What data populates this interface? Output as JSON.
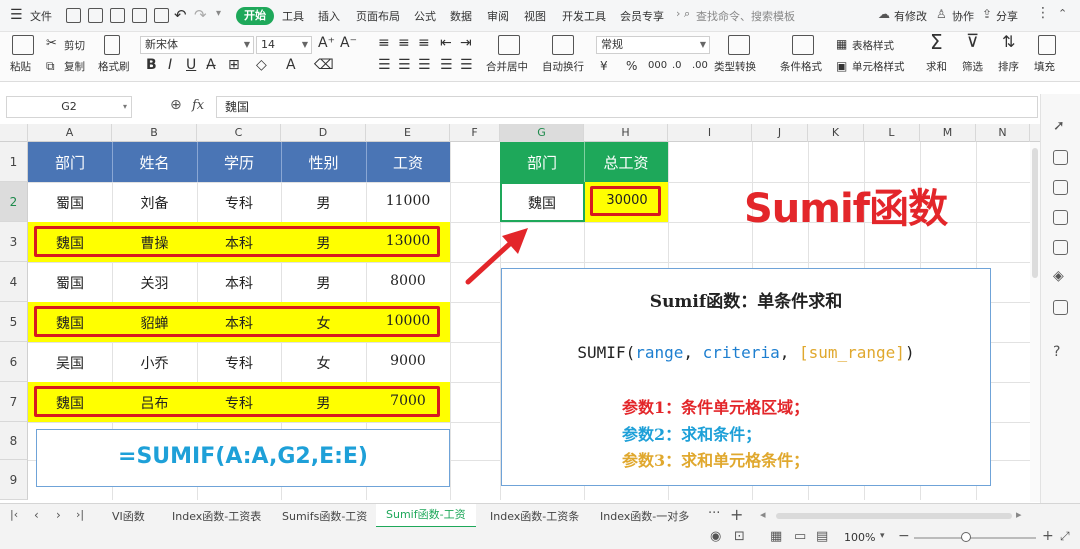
{
  "menubar": {
    "file": "文件",
    "tabs": [
      "开始",
      "工具",
      "插入",
      "页面布局",
      "公式",
      "数据",
      "审阅",
      "视图",
      "开发工具",
      "会员专享"
    ],
    "active_tab": "开始",
    "search_placeholder": "查找命令、搜索模板",
    "has_edit": "有修改",
    "collab": "协作",
    "share": "分享"
  },
  "ribbon": {
    "paste": "粘贴",
    "cut": "剪切",
    "copy": "复制",
    "format_painter": "格式刷",
    "font_name": "新宋体",
    "font_size": "14",
    "merge": "合并居中",
    "wrap": "自动换行",
    "number_format": "常规",
    "type_convert": "类型转换",
    "cond_format": "条件格式",
    "table_style": "表格样式",
    "cell_style": "单元格样式",
    "sum": "求和",
    "filter": "筛选",
    "sort": "排序",
    "fill": "填充"
  },
  "formula_bar": {
    "name_box": "G2",
    "fx": "fx",
    "content": "魏国"
  },
  "columns": [
    "A",
    "B",
    "C",
    "D",
    "E",
    "F",
    "G",
    "H",
    "I",
    "J",
    "K",
    "L",
    "M",
    "N"
  ],
  "rows": [
    "1",
    "2",
    "3",
    "4",
    "5",
    "6",
    "7",
    "8",
    "9"
  ],
  "table": {
    "headers": [
      "部门",
      "姓名",
      "学历",
      "性别",
      "工资"
    ],
    "rows": [
      [
        "蜀国",
        "刘备",
        "专科",
        "男",
        "11000"
      ],
      [
        "魏国",
        "曹操",
        "本科",
        "男",
        "13000"
      ],
      [
        "蜀国",
        "关羽",
        "本科",
        "男",
        "8000"
      ],
      [
        "魏国",
        "貂蝉",
        "本科",
        "女",
        "10000"
      ],
      [
        "吴国",
        "小乔",
        "专科",
        "女",
        "9000"
      ],
      [
        "魏国",
        "吕布",
        "专科",
        "男",
        "7000"
      ]
    ]
  },
  "formula_display": "=SUMIF(A:A,G2,E:E)",
  "result_table": {
    "headers": [
      "部门",
      "总工资"
    ],
    "dept": "魏国",
    "total": "30000"
  },
  "big_title": "Sumif函数",
  "info_box": {
    "title": "Sumif函数：单条件求和",
    "syntax_fn": "SUMIF(",
    "syntax_range": "range",
    "syntax_sep1": ", ",
    "syntax_criteria": "criteria",
    "syntax_sep2": ", ",
    "syntax_sum": "[sum_range]",
    "syntax_close": ")",
    "param1": "参数1：条件单元格区域；",
    "param2": "参数2：求和条件；",
    "param3": "参数3：求和单元格条件；"
  },
  "sheet_tabs": [
    "VI函数",
    "Index函数-工资表",
    "Sumifs函数-工资",
    "Sumif函数-工资",
    "Index函数-工资条",
    "Index函数-一对多"
  ],
  "active_sheet": "Sumif函数-工资",
  "zoom": "100%",
  "colors": {
    "header_blue": "#4a75b5",
    "header_green": "#1ea85a",
    "highlight_yellow": "#ffff00",
    "red": "#d71920",
    "blue_text": "#1ea0d8",
    "gold_text": "#e0a82e"
  }
}
